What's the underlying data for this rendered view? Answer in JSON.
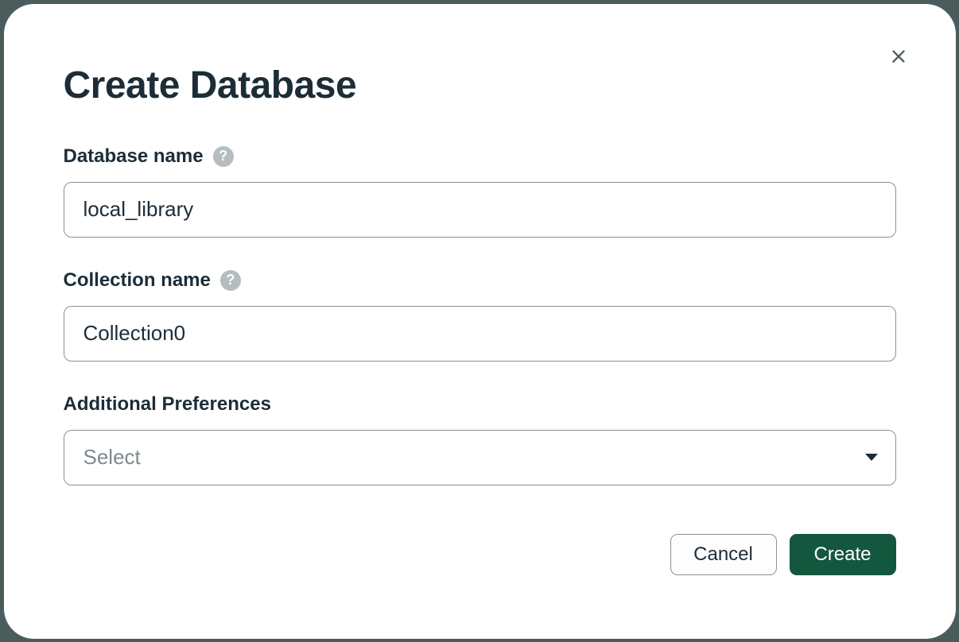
{
  "modal": {
    "title": "Create Database",
    "fields": {
      "database_name": {
        "label": "Database name",
        "value": "local_library"
      },
      "collection_name": {
        "label": "Collection name",
        "value": "Collection0"
      },
      "preferences": {
        "label": "Additional Preferences",
        "placeholder": "Select"
      }
    },
    "buttons": {
      "cancel": "Cancel",
      "create": "Create"
    }
  }
}
